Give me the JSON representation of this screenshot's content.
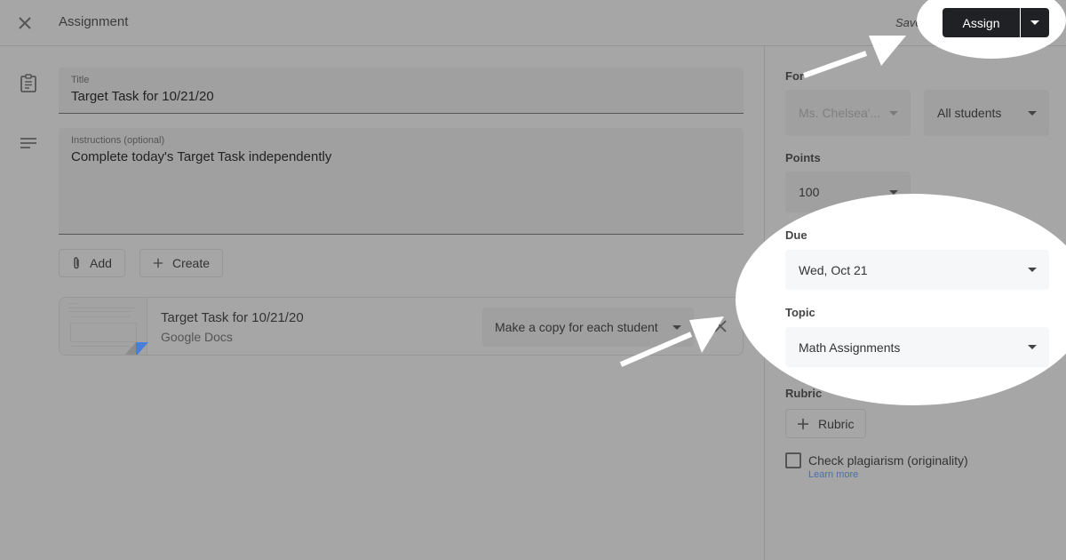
{
  "header": {
    "title": "Assignment",
    "status": "Saved",
    "assign_label": "Assign",
    "close_icon": "close-icon",
    "assign_menu_icon": "caret-down-icon"
  },
  "main": {
    "title_field": {
      "label": "Title",
      "value": "Target Task for 10/21/20",
      "icon": "assignment-clipboard-icon"
    },
    "instructions_field": {
      "label": "Instructions (optional)",
      "value": "Complete today's Target Task independently",
      "icon": "notes-lines-icon"
    },
    "buttons": {
      "add": {
        "label": "Add",
        "icon": "paperclip-icon"
      },
      "create": {
        "label": "Create",
        "icon": "plus-icon"
      }
    },
    "attachment": {
      "title": "Target Task for 10/21/20",
      "type": "Google Docs",
      "sharing_option": "Make a copy for each student",
      "remove_icon": "close-icon",
      "accent_color": "#4a7fd6"
    }
  },
  "sidebar": {
    "for": {
      "label": "For",
      "class_value": "Ms. Chelsea'...",
      "students_value": "All students"
    },
    "points": {
      "label": "Points",
      "value": "100"
    },
    "due": {
      "label": "Due",
      "value": "Wed, Oct 21"
    },
    "topic": {
      "label": "Topic",
      "value": "Math Assignments"
    },
    "rubric": {
      "label": "Rubric",
      "button_label": "Rubric",
      "icon": "plus-icon"
    },
    "plagiarism": {
      "label": "Check plagiarism (originality)",
      "checked": false,
      "link": "Learn more"
    }
  },
  "annotations": {
    "highlight_color": "#ffffff",
    "arrows": [
      "arrow-to-assign-button",
      "arrow-to-remove-attachment"
    ],
    "highlights": [
      "assign-button-highlight",
      "due-topic-highlight"
    ]
  }
}
